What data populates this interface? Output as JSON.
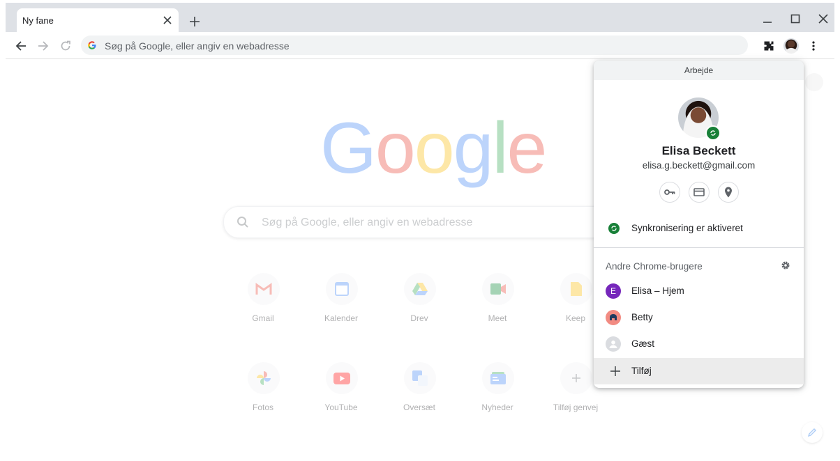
{
  "tabstrip": {
    "tab_title": "Ny fane"
  },
  "toolbar": {
    "omnibox_placeholder": "Søg på Google, eller angiv en webadresse"
  },
  "ntp": {
    "logo_letters": [
      "G",
      "o",
      "o",
      "g",
      "l",
      "e"
    ],
    "logo_colors": [
      "#4285f4",
      "#ea4335",
      "#fbbc05",
      "#4285f4",
      "#34a853",
      "#ea4335"
    ],
    "search_placeholder": "Søg på Google, eller angiv en webadresse",
    "shortcuts": [
      {
        "label": "Gmail",
        "icon": "gmail-icon"
      },
      {
        "label": "Kalender",
        "icon": "calendar-icon"
      },
      {
        "label": "Drev",
        "icon": "drive-icon"
      },
      {
        "label": "Meet",
        "icon": "meet-icon"
      },
      {
        "label": "Keep",
        "icon": "keep-icon"
      },
      {
        "label": "Fotos",
        "icon": "photos-icon"
      },
      {
        "label": "YouTube",
        "icon": "youtube-icon"
      },
      {
        "label": "Oversæt",
        "icon": "translate-icon"
      },
      {
        "label": "Nyheder",
        "icon": "news-icon"
      },
      {
        "label": "Tilføj genvej",
        "icon": "plus-icon"
      }
    ]
  },
  "profile_menu": {
    "header": "Arbejde",
    "name": "Elisa Beckett",
    "email": "elisa.g.beckett@gmail.com",
    "quick_actions": [
      "key-icon",
      "credit-card-icon",
      "location-pin-icon"
    ],
    "sync_status": "Synkronisering er aktiveret",
    "others_title": "Andre Chrome-brugere",
    "others": [
      {
        "label": "Elisa – Hjem",
        "initial": "E",
        "color": "#7627bb"
      },
      {
        "label": "Betty",
        "color": "#f28b82"
      },
      {
        "label": "Gæst",
        "color": "#dadce0"
      }
    ],
    "add_label": "Tilføj"
  },
  "colors": {
    "tabstrip_bg": "#dee1e6",
    "sync_green": "#188038",
    "menu_hover": "#ececec"
  }
}
